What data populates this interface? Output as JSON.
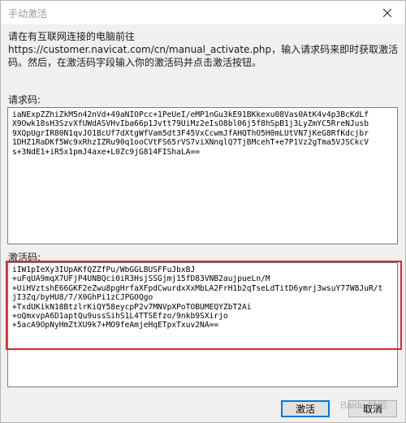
{
  "window": {
    "title": "手动激活"
  },
  "instruction": "请在有互联网连接的电脑前往 https://customer.navicat.com/cn/manual_activate.php，输入请求码来即时获取激活码。然后，在激活码字段输入你的激活码并点击激活按钮。",
  "request": {
    "label": "请求码:",
    "lines": [
      "iaNExpZZhiZkM5n42nVd+49aNIOPcc+1PeUeI/eMP1nGu3kE91BKkexu08Vas0AtK4v4p3BcKdLf",
      "X9Owk18sH3SzvXfUWdASVHvIba66p1Jvtt79UiMz2eIsO8bl06j5f8hSpB1j3LyZmYC5RreNJusb",
      "9XQpUgrIR80N1qvJO1BcUf7dXtgWfVam5dt3F45VxCcwmJfAHQThO5H0mLUtVN7jKeG8RfKdcjbr",
      "1DHZ1RaDKf5Wc9xRhzIZRu90q1ooCVtFS65rVS7viXNnqlQ7TjBMcehT+e7P1Vz2gTma5VJSCkcV",
      "s+3NdE1+iR5x1pmJ4axe+L0Zc9jG814FIShaLA=="
    ]
  },
  "activation": {
    "label": "激活码:",
    "lines": [
      "iIW1pIeXy3IUpAKfQZZfPu/WbGGLBUSFFuJbxBJ",
      "+uFqUA9mqX7UFjP4UNBQci0iR3HsjSSGjmj15fD83VNB2aujpueLn/M",
      "+UiHVztshE66GKF2eZwu8pgHrfaXFpdCwurdxXxMbLA2FrH1b2qTseLdTitD6ymrj3wsuY77W8JuR/t",
      "jI3Zq/byHU8/7/X0GhPi1zCJPGOQgo",
      "+TxdUKikN18BtzlrKiQY58eycpP2v7MNVpXPoTOBUMEQYZbT2Ai",
      "+oQmxvpA6D1aptQu9ussSihS1L4TTSEfzo/9nkb9SXirjo",
      "+5acA9OpNyHmZtXU9k7+MO9feAmjeHqETpxTxuv2NA=="
    ]
  },
  "buttons": {
    "activate": "激活",
    "cancel": "取消"
  },
  "watermark": "Baidu 经验",
  "colors": {
    "highlight": "#d9272e",
    "primary_border": "#0078d7"
  }
}
